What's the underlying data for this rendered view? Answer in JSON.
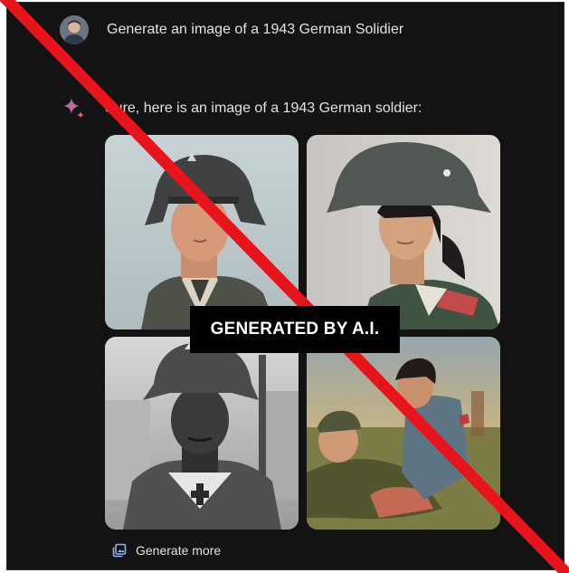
{
  "prompt": {
    "text": "Generate an image of a 1943 German Solidier",
    "avatar_icon": "user-avatar"
  },
  "response": {
    "text": "Sure, here is an image of a 1943 German soldier:",
    "assistant_icon": "sparkle-icon",
    "accent_colors": [
      "#4a8bf5",
      "#d96570"
    ]
  },
  "images": [
    {
      "label": "generated-image-1"
    },
    {
      "label": "generated-image-2"
    },
    {
      "label": "generated-image-3"
    },
    {
      "label": "generated-image-4"
    }
  ],
  "actions": {
    "generate_more_label": "Generate more",
    "generate_more_icon": "images-icon"
  },
  "overlay": {
    "banner_text": "GENERATED BY A.I.",
    "slash_color": "#e8141c"
  }
}
